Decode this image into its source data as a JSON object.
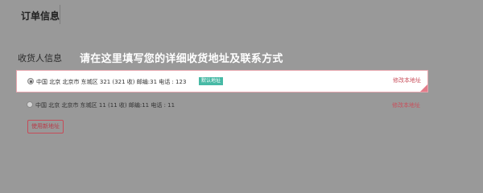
{
  "header": {
    "title": "订单信息"
  },
  "receiver_section": {
    "label": "收货人信息",
    "hint": "请在这里填写您的详细收货地址及联系方式"
  },
  "addresses": [
    {
      "text": "中国 北京 北京市 东城区 321 (321 收) 邮编:31 电话 : 123",
      "badge": "默认地址",
      "edit_label": "修改本地址",
      "selected": true
    },
    {
      "text": "中国 北京 北京市 东城区 11 (11 收) 邮编:11 电话 : 11",
      "edit_label": "修改本地址",
      "selected": false
    }
  ],
  "actions": {
    "use_new_address": "使用新地址"
  },
  "colors": {
    "accent": "#c9505c",
    "badge": "#47b9a5",
    "overlay_bg": "#999999"
  }
}
